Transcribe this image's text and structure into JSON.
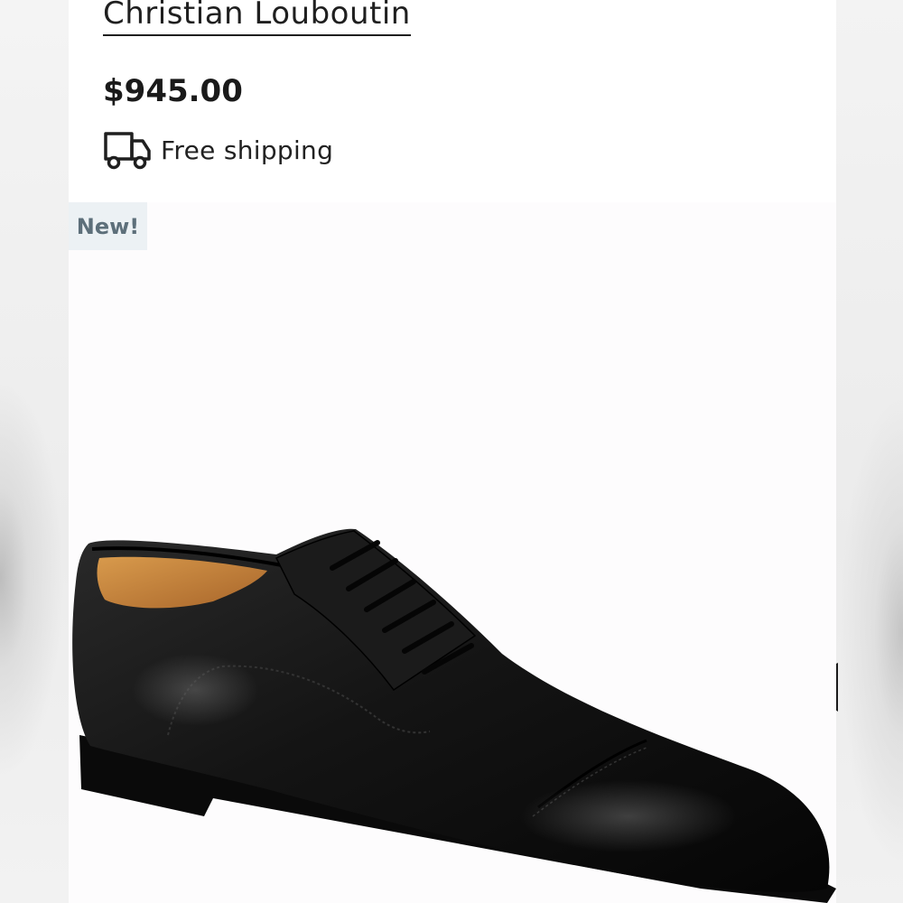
{
  "listing": {
    "brand": "Christian Louboutin",
    "price": "$945.00",
    "shipping_label": "Free shipping",
    "badge": "New!",
    "shipping_icon": "truck-icon",
    "image": {
      "subject": "black leather cap-toe oxford shoe",
      "colors": {
        "leather": "#121212",
        "lining": "#c9843a",
        "background": "#fdfcfd"
      }
    }
  },
  "colors": {
    "text": "#1f1f1f",
    "badge_bg": "#ecf1f4",
    "badge_text": "#5d6f7a"
  }
}
